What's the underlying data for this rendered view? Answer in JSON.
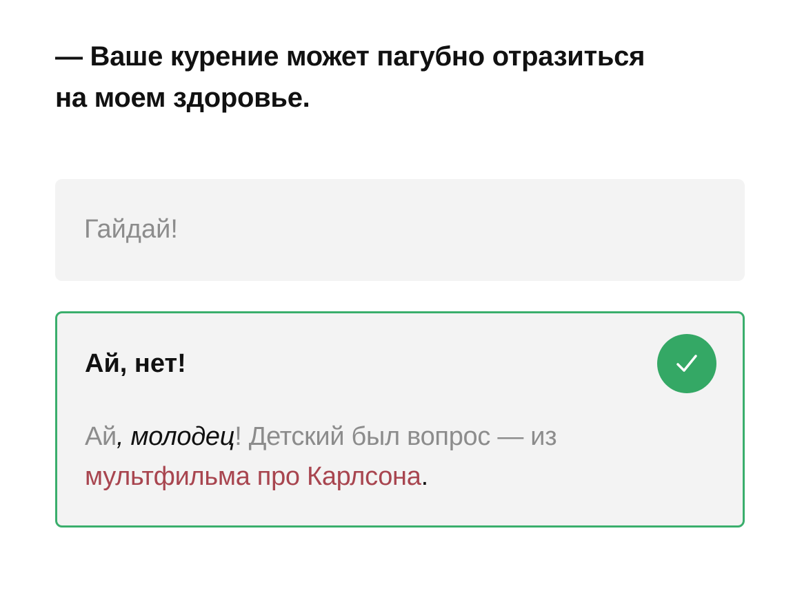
{
  "question": {
    "text_line1": "— Ваше курение может пагубно отразиться",
    "text_line2": "на моем здоровье."
  },
  "options": [
    {
      "label": "Гайдай!",
      "state": "unselected"
    },
    {
      "label": "Ай, нет!",
      "state": "correct",
      "icon": "check-icon",
      "explanation": {
        "part1": "Ай",
        "part2": ", молодец",
        "part3": "! Детский был вопрос — из",
        "link": "мультфильма про Карлсона",
        "end": "."
      }
    }
  ],
  "colors": {
    "correct_border": "#3aae6c",
    "check_badge": "#34a865",
    "card_background": "#f3f3f3",
    "link": "#a8454f"
  }
}
